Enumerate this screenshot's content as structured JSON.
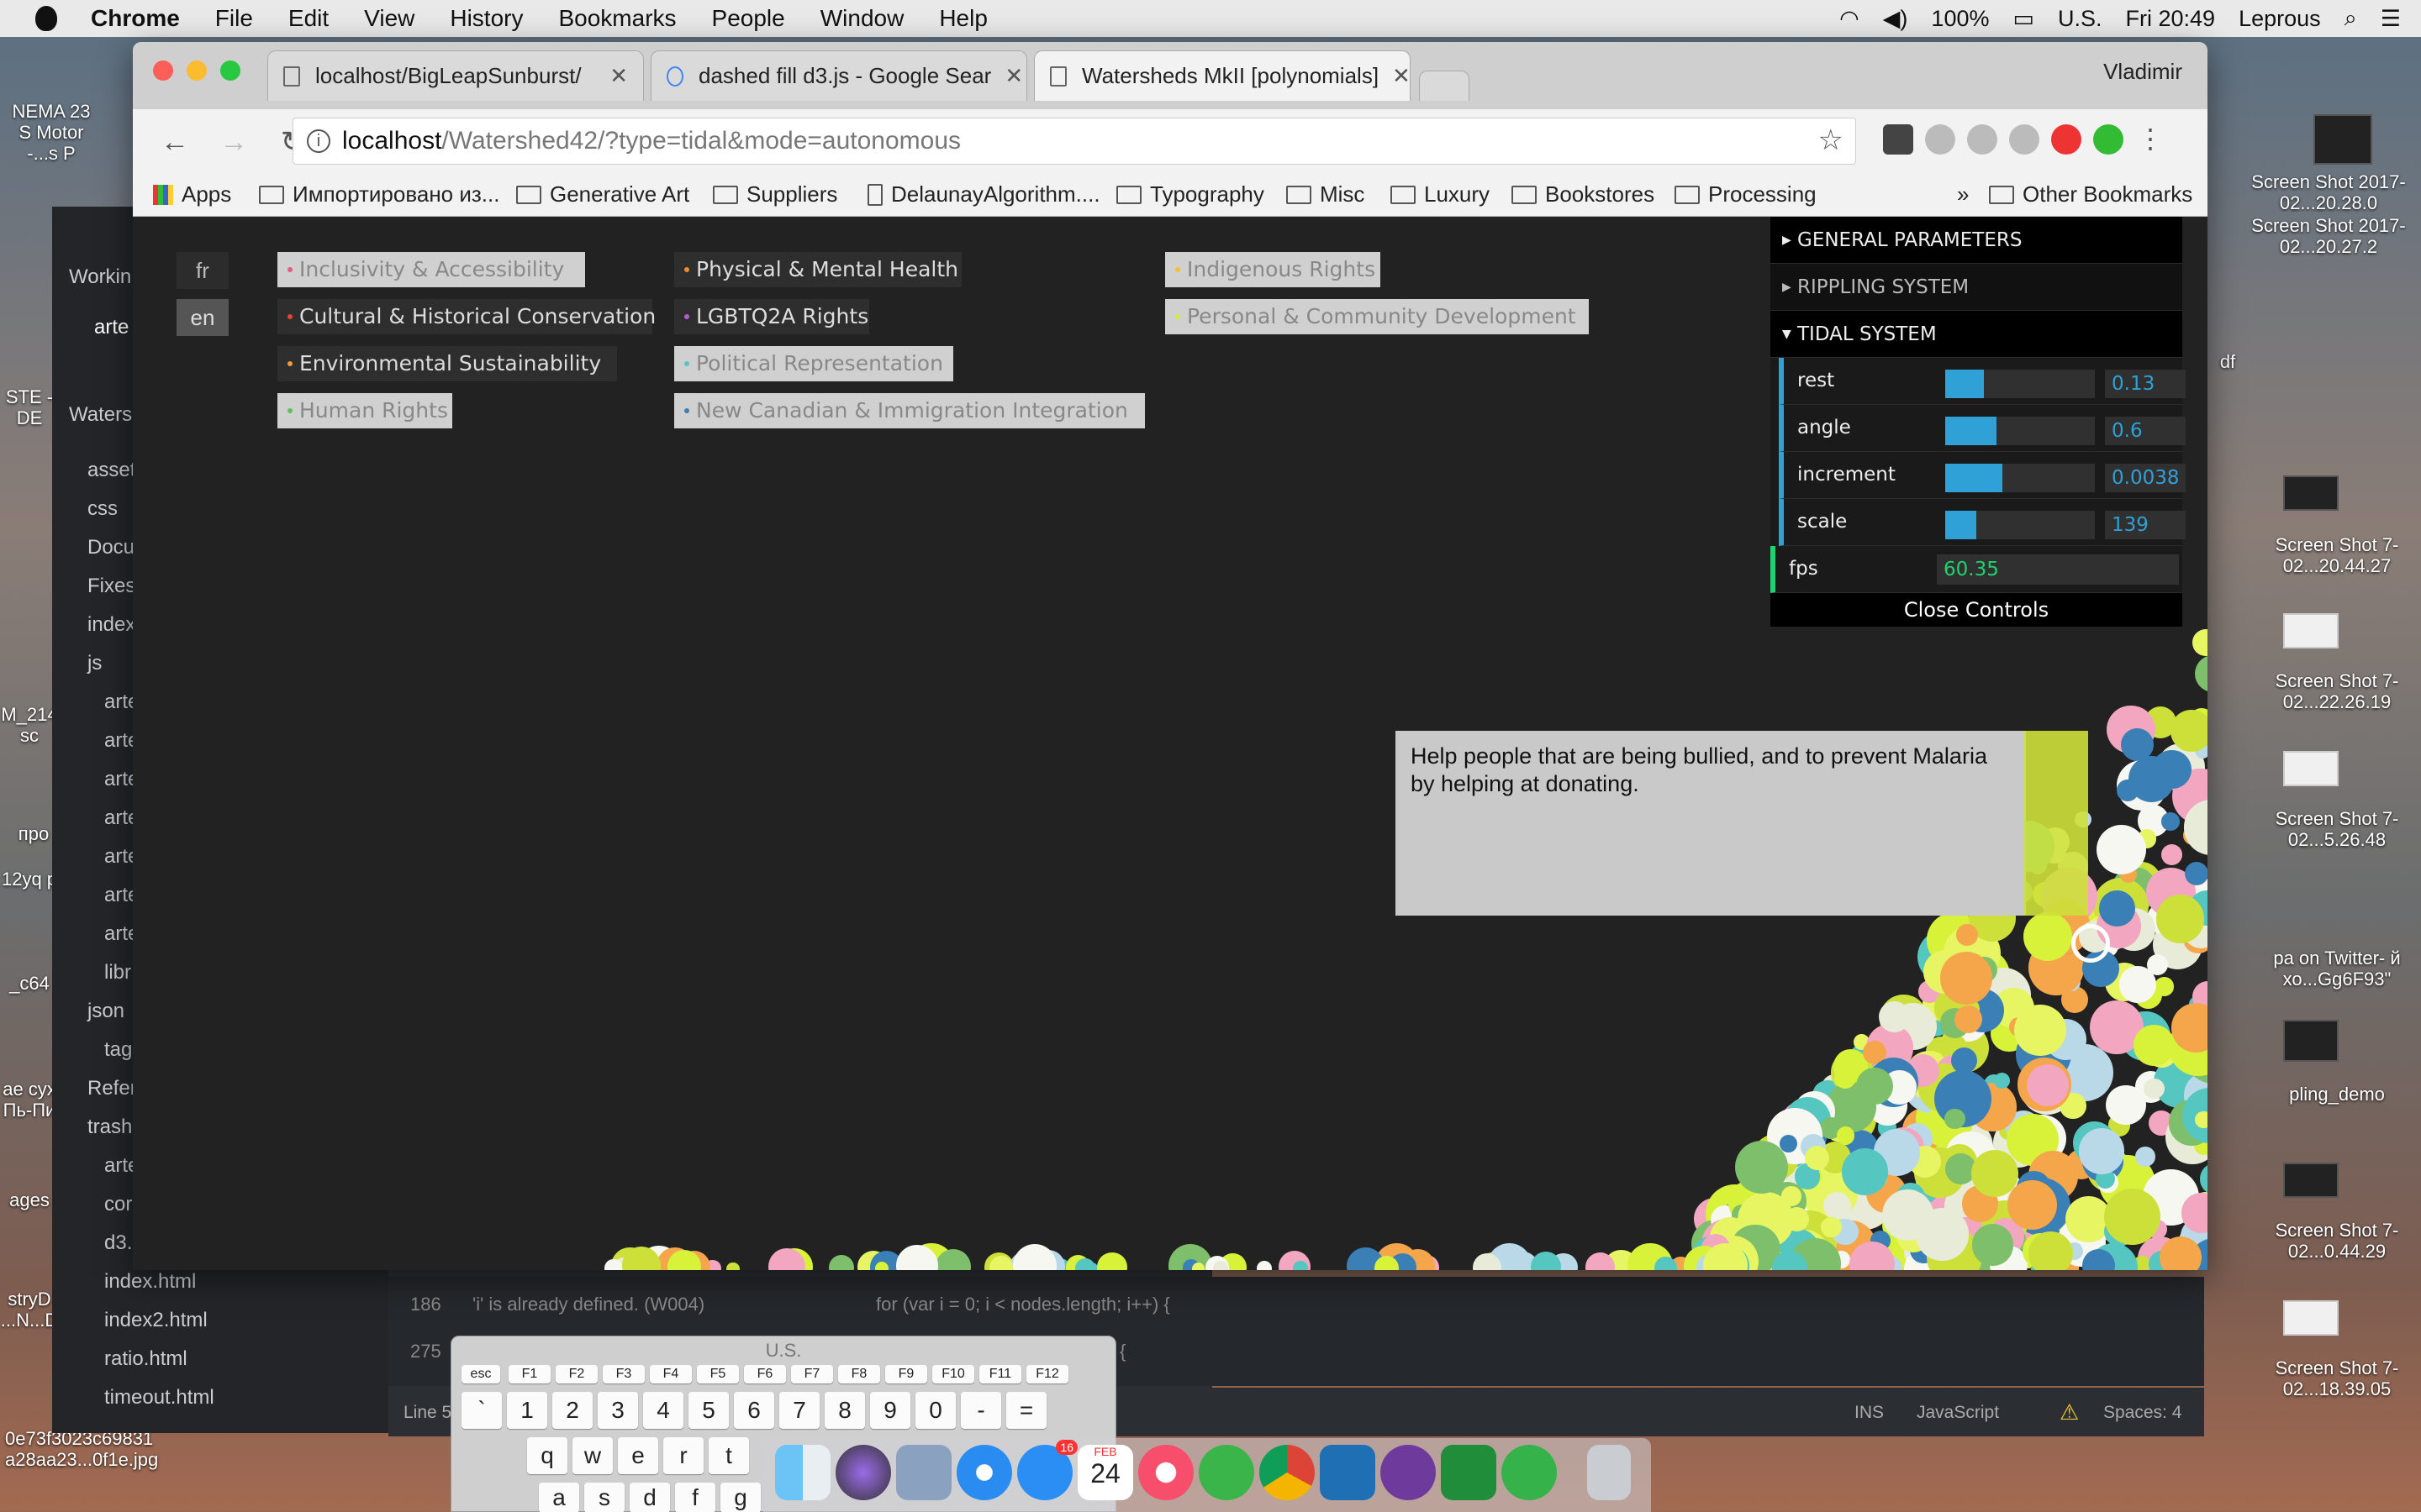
{
  "menubar": {
    "app": "Chrome",
    "items": [
      "File",
      "Edit",
      "View",
      "History",
      "Bookmarks",
      "People",
      "Window",
      "Help"
    ],
    "battery": "100%",
    "input": "U.S.",
    "clock": "Fri 20:49",
    "user": "Leprous"
  },
  "desktop": {
    "left_items": [
      "NEMA 23 S Motor -...s P",
      "STE - DE",
      "M_214 sc",
      "про",
      "12yq p",
      "_c64",
      "ae сух Пь-Пи",
      "ages",
      "stryD ...N...D",
      "0e73f3023c69831 a28aa23...0f1e.jpg"
    ],
    "right_items": [
      "Screen Shot 2017-02...20.28.0",
      "Screen Shot 2017-02...20.27.2",
      "Screen Shot 7-02...20.44.27",
      "Screen Shot 7-02...22.26.19",
      "Screen Shot 7-02...5.26.48",
      "pa on Twitter- й хо...Gg6F93\"",
      "pling_demo",
      "Screen Shot 7-02...0.44.29",
      "Screen Shot 7-02...18.39.05",
      "df"
    ]
  },
  "editor": {
    "sidebar": [
      "Workin",
      "arte",
      "Waters",
      "asset",
      "css",
      "Docu",
      "Fixes",
      "index",
      "js",
      "arte",
      "arte",
      "arte",
      "arte",
      "arte",
      "arte",
      "arte",
      "libr",
      "json",
      "tag",
      "Refer",
      "trash",
      "arte",
      "cor",
      "d3.",
      "index.html",
      "index2.html",
      "ratio.html",
      "timeout.html"
    ],
    "lint": [
      {
        "line": "186",
        "msg": "'i' is already defined. (W004)",
        "code": "for (var i = 0; i < nodes.length; i++) {"
      },
      {
        "line": "275",
        "msg": "",
        "code": "{"
      }
    ],
    "status": {
      "line": "Line 5",
      "ins": "INS",
      "lang": "JavaScript",
      "spaces": "Spaces: 4"
    }
  },
  "chrome": {
    "tabs": [
      {
        "title": "localhost/BigLeapSunburst/"
      },
      {
        "title": "dashed fill d3.js - Google Sear"
      },
      {
        "title": "Watersheds MkII [polynomials]"
      }
    ],
    "profile": "Vladimir",
    "url": {
      "host": "localhost",
      "path": "/Watershed42/?type=tidal&mode=autonomous"
    },
    "bookmarks": [
      "Apps",
      "Импортировано из...",
      "Generative Art",
      "Suppliers",
      "DelaunayAlgorithm....",
      "Typography",
      "Misc",
      "Luxury",
      "Bookstores",
      "Processing",
      "Other Bookmarks"
    ]
  },
  "page": {
    "langs": [
      "fr",
      "en"
    ],
    "tags": [
      {
        "label": "Inclusivity & Accessibility",
        "dot": "#e85a7a",
        "state": "dim"
      },
      {
        "label": "Cultural & Historical Conservation",
        "dot": "#e8432e",
        "state": "norm"
      },
      {
        "label": "Environmental Sustainability",
        "dot": "#f29a3a",
        "state": "norm"
      },
      {
        "label": "Human Rights",
        "dot": "#5cc25a",
        "state": "dim"
      },
      {
        "label": "Physical & Mental Health",
        "dot": "#f28a2e",
        "state": "norm"
      },
      {
        "label": "LGBTQ2A Rights",
        "dot": "#b75ad6",
        "state": "norm"
      },
      {
        "label": "Political Representation",
        "dot": "#55c6c0",
        "state": "dim"
      },
      {
        "label": "New Canadian & Immigration Integration",
        "dot": "#3a7fb5",
        "state": "dim"
      },
      {
        "label": "Indigenous Rights",
        "dot": "#f2c12e",
        "state": "dim"
      },
      {
        "label": "Personal & Community Development",
        "dot": "#d6e83a",
        "state": "dim"
      }
    ],
    "gui": {
      "folders": [
        "GENERAL PARAMETERS",
        "RIPPLING SYSTEM",
        "TIDAL SYSTEM"
      ],
      "controls": [
        {
          "label": "rest",
          "value": "0.13",
          "level": 0.26
        },
        {
          "label": "angle",
          "value": "0.6",
          "level": 0.34
        },
        {
          "label": "increment",
          "value": "0.0038",
          "level": 0.38
        },
        {
          "label": "scale",
          "value": "139",
          "level": 0.21
        }
      ],
      "fps_label": "fps",
      "fps": "60.35",
      "close": "Close Controls"
    },
    "tooltip": "Help people that are being bullied, and to prevent Malaria by helping at donating."
  },
  "keyboard": {
    "title": "U.S.",
    "fkeys": [
      "esc",
      "F1",
      "F2",
      "F3",
      "F4",
      "F5",
      "F6",
      "F7",
      "F8",
      "F9",
      "F10",
      "F11",
      "F12"
    ],
    "row1": [
      "`",
      "1",
      "2",
      "3",
      "4",
      "5",
      "6",
      "7",
      "8",
      "9",
      "0",
      "-",
      "="
    ],
    "row2": [
      "q",
      "w",
      "e",
      "r",
      "t"
    ],
    "row3": [
      "a",
      "s",
      "d",
      "f",
      "g"
    ]
  },
  "dock": {
    "calendar_month": "FEB",
    "calendar_day": "24",
    "appstore_badge": "16"
  },
  "colors": {
    "gui_blue": "#2fa1d6",
    "gui_green": "#1ed36f",
    "page_bg": "#222223"
  }
}
